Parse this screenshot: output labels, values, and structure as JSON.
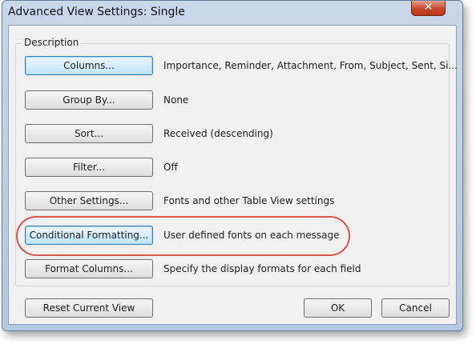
{
  "dialog": {
    "title": "Advanced View Settings: Single",
    "close_glyph": "✕",
    "group_label": "Description",
    "rows": [
      {
        "button": "Columns...",
        "description": "Importance, Reminder, Attachment, From, Subject, Sent, Si..."
      },
      {
        "button": "Group By...",
        "description": "None"
      },
      {
        "button": "Sort...",
        "description": "Received (descending)"
      },
      {
        "button": "Filter...",
        "description": "Off"
      },
      {
        "button": "Other Settings...",
        "description": "Fonts and other Table View settings"
      },
      {
        "button": "Conditional Formatting...",
        "description": "User defined fonts on each message"
      },
      {
        "button": "Format Columns...",
        "description": "Specify the display formats for each field"
      }
    ],
    "footer": {
      "reset": "Reset Current View",
      "ok": "OK",
      "cancel": "Cancel"
    },
    "annotation_color": "#d9534f",
    "focus_color": "#bee6fd"
  }
}
